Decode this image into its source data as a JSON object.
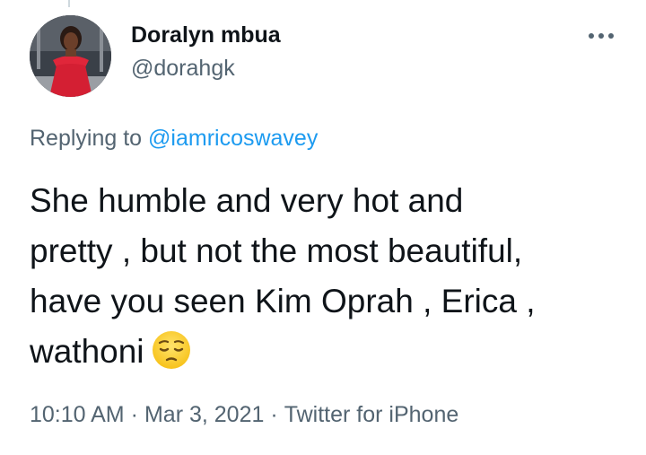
{
  "author": {
    "display_name": "Doralyn mbua",
    "handle": "@dorahgk"
  },
  "menu": {
    "icon": "more-horizontal-icon"
  },
  "reply": {
    "prefix": "Replying to ",
    "mention": "@iamricoswavey"
  },
  "tweet": {
    "lines": [
      "She humble and very hot and",
      "pretty , but not the most beautiful,",
      "have you seen Kim Oprah , Erica ,",
      "wathoni"
    ],
    "emoji": "pensive-face-emoji"
  },
  "meta": {
    "time": "10:10 AM",
    "separator": "·",
    "date": "Mar 3, 2021",
    "source": "Twitter for iPhone"
  },
  "colors": {
    "text_primary": "#0f1419",
    "text_secondary": "#536471",
    "link": "#1d9bf0"
  }
}
